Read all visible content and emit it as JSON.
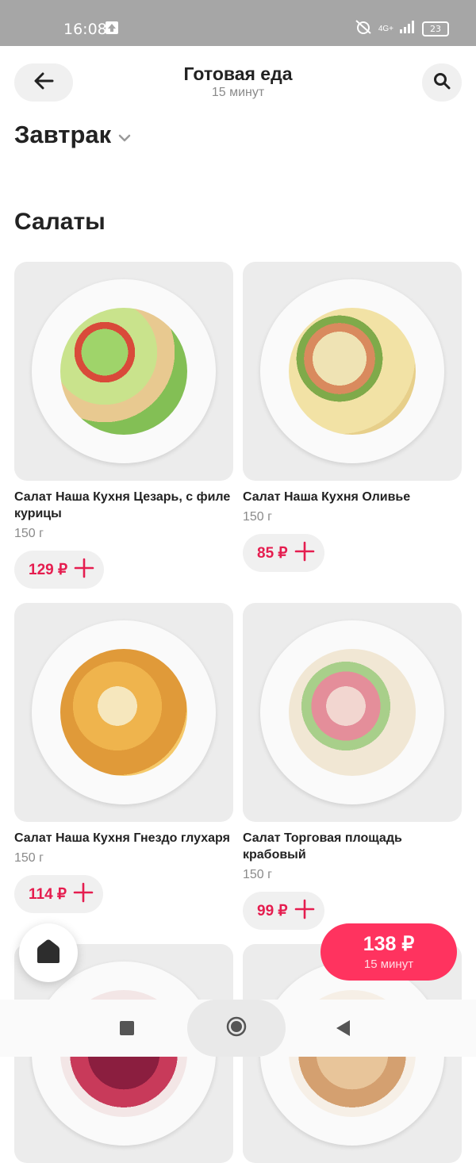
{
  "status_bar": {
    "time": "16:08",
    "network": "4G+",
    "battery": "23"
  },
  "header": {
    "title": "Готовая еда",
    "subtitle": "15 минут"
  },
  "category": {
    "selected": "Завтрак"
  },
  "section": {
    "title": "Салаты"
  },
  "products": [
    {
      "name": "Салат Наша Кухня Цезарь, с филе курицы",
      "weight": "150 г",
      "price": "129 ₽"
    },
    {
      "name": "Салат Наша Кухня Оливье",
      "weight": "150 г",
      "price": "85 ₽"
    },
    {
      "name": "Салат Наша Кухня Гнездо глухаря",
      "weight": "150 г",
      "price": "114 ₽"
    },
    {
      "name": "Салат Торговая площадь крабовый",
      "weight": "150 г",
      "price": "99 ₽"
    }
  ],
  "cart": {
    "price": "138 ₽",
    "time": "15 минут"
  },
  "colors": {
    "accent": "#ff335f",
    "price_text": "#e51d4f",
    "button_bg": "#f0f0f0"
  }
}
